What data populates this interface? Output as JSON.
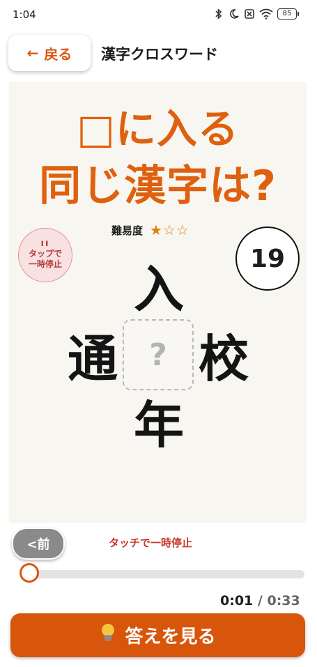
{
  "status_bar": {
    "time": "1:04",
    "battery": "85"
  },
  "header": {
    "back_arrow": "←",
    "back_label": "戻る",
    "title": "漢字クロスワード"
  },
  "puzzle": {
    "title_line_1": "□に入る",
    "title_line_2": "同じ漢字は?",
    "difficulty_label": "難易度",
    "difficulty_stars": "★☆☆",
    "difficulty_value": 1,
    "difficulty_max": 3,
    "pause_badge_icon": "ıı",
    "pause_badge_line1": "タップで",
    "pause_badge_line2": "一時停止",
    "number": "19",
    "kanji_top": "入",
    "kanji_left": "通",
    "kanji_right": "校",
    "kanji_bottom": "年",
    "answer_placeholder": "?"
  },
  "controls": {
    "prev_label": "<前",
    "tap_pause_text": "タッチで一時停止",
    "elapsed": "0:01",
    "separator": "/",
    "total": "0:33",
    "progress_fraction": 0.03,
    "answer_button_label": "答えを見る",
    "answer_button_icon": "lightbulb-icon"
  },
  "colors": {
    "accent": "#d9580f",
    "panel_bg": "#f8f6f1"
  }
}
